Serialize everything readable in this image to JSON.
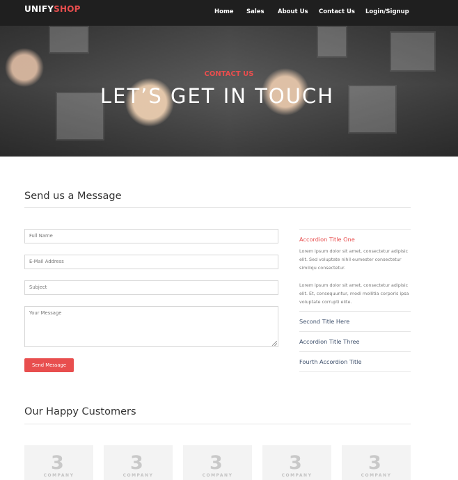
{
  "brand": {
    "part1": "UNIFY",
    "part2": "SHOP",
    "accent_color": "#e84e4e"
  },
  "nav": {
    "items": [
      "Home",
      "Sales",
      "About Us",
      "Contact Us",
      "Login/Signup"
    ]
  },
  "hero": {
    "subtitle": "CONTACT US",
    "title": "LET’S GET IN TOUCH"
  },
  "contact": {
    "section_title": "Send us a Message",
    "fields": {
      "full_name_placeholder": "Full Name",
      "email_placeholder": "E-Mail Address",
      "subject_placeholder": "Subject",
      "message_placeholder": "Your Message"
    },
    "send_label": "Send Message"
  },
  "accordion": {
    "items": [
      {
        "title": "Accordion Title One",
        "active": true
      },
      {
        "title": "Second Title Here",
        "active": false
      },
      {
        "title": "Accordion Title Three",
        "active": false
      },
      {
        "title": "Fourth Accordion Title",
        "active": false
      }
    ],
    "paragraph_1": "Lorem ipsum dolor sit amet, consectetur adipisic elit. Sed voluptate nihil eumester consectetur similiqu consectetur.",
    "paragraph_2": "Lorem ipsum dolor sit amet, consectetur adipisic elit. Et, consequuntur, modi mollitia corporis ipsa voluptate corrupti elite."
  },
  "customers": {
    "section_title": "Our Happy Customers",
    "logos": [
      {
        "mark": "3",
        "label": "COMPANY"
      },
      {
        "mark": "3",
        "label": "COMPANY"
      },
      {
        "mark": "3",
        "label": "COMPANY"
      },
      {
        "mark": "3",
        "label": "COMPANY"
      },
      {
        "mark": "3",
        "label": "COMPANY"
      }
    ]
  }
}
